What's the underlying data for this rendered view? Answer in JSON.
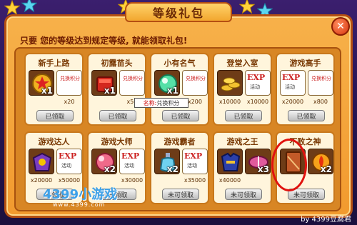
{
  "window": {
    "title": "等级礼包",
    "close_label": "✕",
    "notice": "只要 您的等级达到规定等级, 就能领取礼包!"
  },
  "tooltip": {
    "label": "名称:",
    "value": "兑换积分"
  },
  "watermark": {
    "brand": "4399小游戏",
    "url": "www.4399.com"
  },
  "byline": "by 4399豆腐君",
  "colors": {
    "accent": "#f29a2e",
    "border": "#b54f12",
    "card_bg": "#fff5dc",
    "ring": "#e0120e"
  },
  "packs": [
    {
      "title": "新手上路",
      "button": "已领取",
      "items": [
        {
          "icon": "star-medal-icon",
          "qty": "x1"
        },
        {
          "icon": "exchange-points-icon",
          "text": "兑换积分",
          "value": "x20"
        }
      ]
    },
    {
      "title": "初露苗头",
      "button": "已领取",
      "items": [
        {
          "icon": "red-cube-icon",
          "qty": "x1"
        },
        {
          "icon": "exchange-points-icon",
          "text": "兑换积分",
          "value": "x50"
        }
      ]
    },
    {
      "title": "小有名气",
      "button": "已领取",
      "items": [
        {
          "icon": "green-orb-icon",
          "qty": "x1"
        },
        {
          "icon": "exchange-points-icon",
          "text": "兑换积分",
          "value": "x200"
        }
      ]
    },
    {
      "title": "登堂入室",
      "button": "已领取",
      "items": [
        {
          "icon": "gold-coins-icon",
          "value": "x10000"
        },
        {
          "icon": "exp-icon",
          "text": "EXP",
          "sub": "活动",
          "value": "x10000"
        }
      ]
    },
    {
      "title": "游戏高手",
      "button": "已领取",
      "items": [
        {
          "icon": "exp-icon",
          "text": "EXP",
          "sub": "活动",
          "value": "x20000"
        },
        {
          "icon": "exchange-points-icon",
          "text": "兑换积分",
          "value": "x800"
        }
      ]
    },
    {
      "title": "游戏达人",
      "button": "已领取",
      "items": [
        {
          "icon": "armor-icon",
          "value": "x20000"
        },
        {
          "icon": "exp-icon",
          "text": "EXP",
          "sub": "活动",
          "value": "x50000"
        }
      ]
    },
    {
      "title": "游戏大师",
      "button": "已领取",
      "items": [
        {
          "icon": "pink-orb-icon",
          "qty": "x2"
        },
        {
          "icon": "exp-icon",
          "text": "EXP",
          "sub": "活动",
          "value": "x30000"
        }
      ]
    },
    {
      "title": "游戏霸者",
      "button": "未可领取",
      "items": [
        {
          "icon": "potion-icon",
          "qty": "x2"
        },
        {
          "icon": "exp-icon",
          "text": "EXP",
          "sub": "活动",
          "value": "x35000"
        }
      ]
    },
    {
      "title": "游戏之王",
      "button": "未可领取",
      "items": [
        {
          "icon": "blue-cloth-icon",
          "value": "x40000"
        },
        {
          "icon": "pink-capsule-icon",
          "qty": "x3"
        }
      ]
    },
    {
      "title": "不败之神",
      "button": "未可领取",
      "items": [
        {
          "icon": "card-icon"
        },
        {
          "icon": "fire-orb-icon",
          "qty": "x2"
        }
      ]
    }
  ]
}
